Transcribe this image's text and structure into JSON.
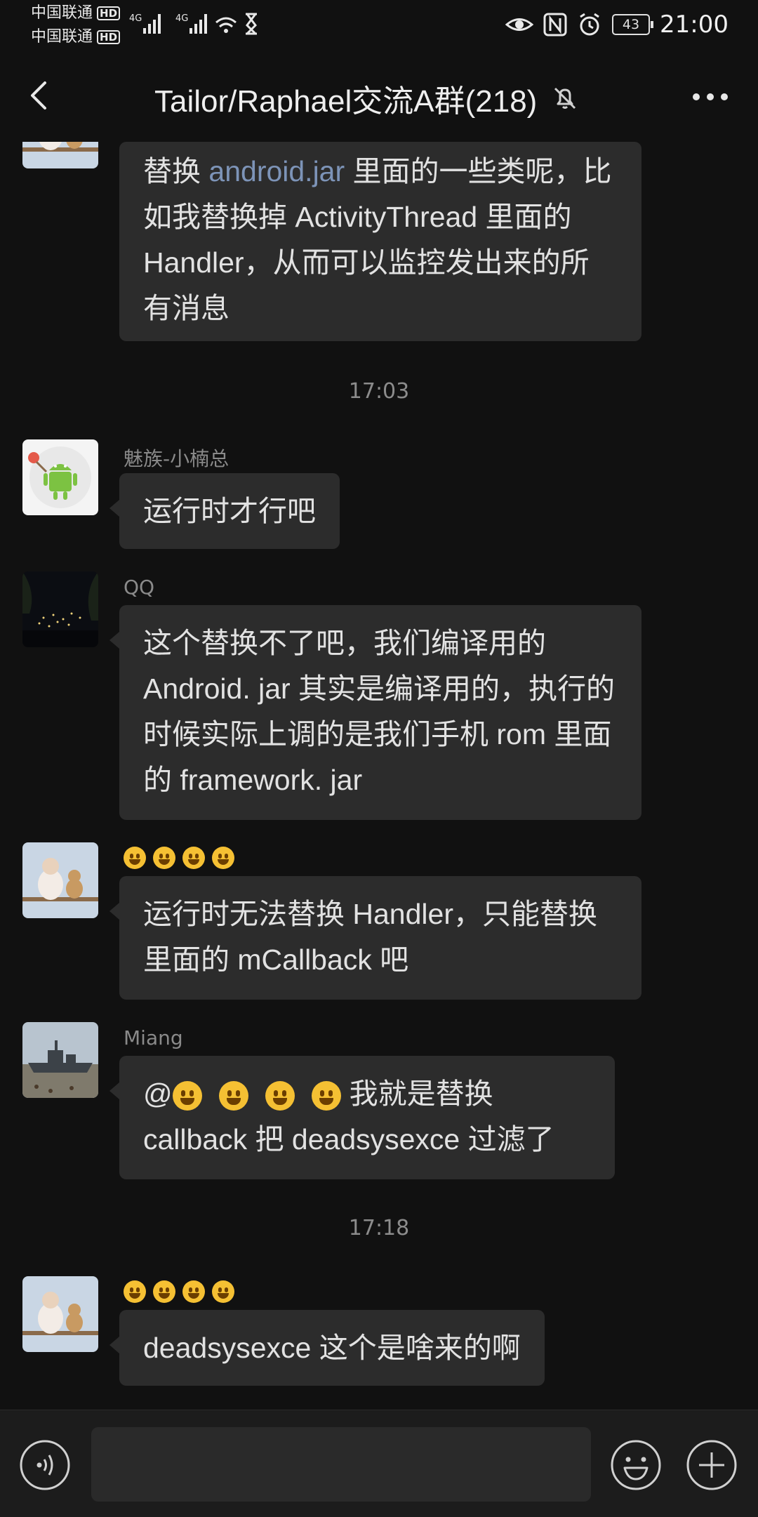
{
  "status_bar": {
    "carrier_1": "中国联通",
    "carrier_2": "中国联通",
    "hd_badge": "HD",
    "network_1": "4G",
    "network_2": "4G",
    "battery": "43",
    "time": "21:00"
  },
  "header": {
    "title": "Tailor/Raphael交流A群(218)"
  },
  "messages": [
    {
      "kind": "text",
      "segments": [
        {
          "text": "替换 "
        },
        {
          "text": "android.jar",
          "link": true
        },
        {
          "text": " 里面的一些类呢，比如我替换掉 ActivityThread 里面的 Handler，从而可以监控发出来的所有消息"
        }
      ]
    },
    {
      "kind": "time",
      "text": "17:03"
    },
    {
      "kind": "text",
      "sender": "魅族-小楠总",
      "text": "运行时才行吧"
    },
    {
      "kind": "text",
      "sender": "QQ",
      "text": "这个替换不了吧，我们编译用的 Android. jar 其实是编译用的，执行的时候实际上调的是我们手机 rom 里面的 framework. jar"
    },
    {
      "kind": "text",
      "sender_emoji": [
        "joy-emoji",
        "grin-emoji",
        "smiley-emoji",
        "grin-emoji"
      ],
      "text": "运行时无法替换 Handler，只能替换里面的 mCallback 吧"
    },
    {
      "kind": "text",
      "sender": "Miang",
      "prefix": "@",
      "text": "我就是替换 callback 把 deadsysexce 过滤了"
    },
    {
      "kind": "time",
      "text": "17:18"
    },
    {
      "kind": "text",
      "sender_emoji": [
        "joy-emoji",
        "grin-emoji",
        "smiley-emoji",
        "grin-emoji"
      ],
      "text": "deadsysexce 这个是啥来的啊"
    }
  ],
  "input_bar": {
    "voice_icon": "voice-icon",
    "emoji_icon": "emoji-icon",
    "plus_icon": "plus-icon",
    "message_value": ""
  },
  "colors": {
    "background": "#111111",
    "bubble": "#2c2c2c",
    "link": "#7d94b8",
    "meta_text": "#8a8a8a"
  }
}
